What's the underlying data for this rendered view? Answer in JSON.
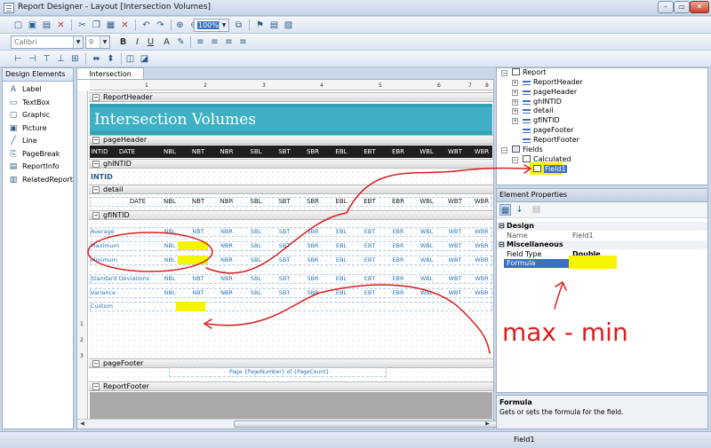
{
  "window": {
    "title": "Report Designer - Layout [Intersection Volumes]",
    "buttons": [
      "minimize",
      "maximize",
      "close"
    ]
  },
  "toolbar1": {
    "zoom": "100%"
  },
  "toolbar2": {
    "font": "Calibri",
    "size": "9",
    "bold": "B",
    "italic": "I",
    "underline": "U",
    "font_color": "A"
  },
  "left_panel": {
    "title": "Design Elements",
    "items": [
      "Label",
      "TextBox",
      "Graphic",
      "Picture",
      "Line",
      "PageBreak",
      "ReportInfo",
      "RelatedReport"
    ]
  },
  "tab": "Intersection Volumes",
  "ruler": [
    "1",
    "2",
    "3",
    "4",
    "5",
    "6",
    "7",
    "8"
  ],
  "ruler_left": [
    "1",
    "2",
    "3"
  ],
  "bands": {
    "report_header": "ReportHeader",
    "page_header": "pageHeader",
    "gh": "ghINTID",
    "detail": "detail",
    "gf": "gfINTID",
    "page_footer": "pageFooter",
    "report_footer": "ReportFooter"
  },
  "report_title": "Intersection Volumes",
  "columns": [
    "INTID",
    "DATE",
    "NBL",
    "NBT",
    "NBR",
    "SBL",
    "SBT",
    "SBR",
    "EBL",
    "EBT",
    "EBR",
    "WBL",
    "WBT",
    "WBR"
  ],
  "gh_field": "INTID",
  "detail_cols": [
    "DATE",
    "NBL",
    "NBT",
    "NBR",
    "SBL",
    "SBT",
    "SBR",
    "EBL",
    "EBT",
    "EBR",
    "WBL",
    "WBT",
    "WBR"
  ],
  "group_rows": [
    {
      "label": "Average",
      "cols": [
        "NBL",
        "NBT",
        "NBR",
        "SBL",
        "SBT",
        "SBR",
        "EBL",
        "EBT",
        "EBR",
        "WBL",
        "WBT",
        "WBR"
      ]
    },
    {
      "label": "Maximum",
      "cols": [
        "NBL",
        "NBT",
        "NBR",
        "SBL",
        "SBT",
        "SBR",
        "EBL",
        "EBT",
        "EBR",
        "WBL",
        "WBT",
        "WBR"
      ]
    },
    {
      "label": "Minimum",
      "cols": [
        "NBL",
        "NBT",
        "NBR",
        "SBL",
        "SBT",
        "SBR",
        "EBL",
        "EBT",
        "EBR",
        "WBL",
        "WBT",
        "WBR"
      ]
    },
    {
      "label": "Standard Deviations",
      "cols": [
        "NBL",
        "NBT",
        "NBR",
        "SBL",
        "SBT",
        "SBR",
        "EBL",
        "EBT",
        "EBR",
        "WBL",
        "WBT",
        "WBR"
      ]
    },
    {
      "label": "Variance",
      "cols": [
        "NBL",
        "NBT",
        "NBR",
        "SBL",
        "SBT",
        "SBR",
        "EBL",
        "EBT",
        "EBR",
        "WBL",
        "WBT",
        "WBR"
      ]
    },
    {
      "label": "Custom",
      "cols": []
    }
  ],
  "page_footer_text": "Page {PageNumber} of {PageCount}",
  "tree": {
    "report": "Report",
    "sections": [
      "ReportHeader",
      "pageHeader",
      "ghINTID",
      "detail",
      "gfINTID",
      "pageFooter",
      "ReportFooter"
    ],
    "fields": "Fields",
    "calculated": "Calculated",
    "field1": "Field1"
  },
  "properties": {
    "title": "Element Properties",
    "cat_design": "Design",
    "name_key": "Name",
    "name_val": "Field1",
    "cat_misc": "Miscellaneous",
    "type_key": "Field Type",
    "type_val": "Double",
    "formula_key": "Formula"
  },
  "description": {
    "title": "Formula",
    "text": "Gets or sets the formula for the field."
  },
  "status": "Field1",
  "annotation": "max - min",
  "colors": {
    "header_teal": "#3fb0c3",
    "highlight": "#f5f500",
    "annotation": "#d81e1e",
    "blue_text": "#2a7bbf"
  }
}
